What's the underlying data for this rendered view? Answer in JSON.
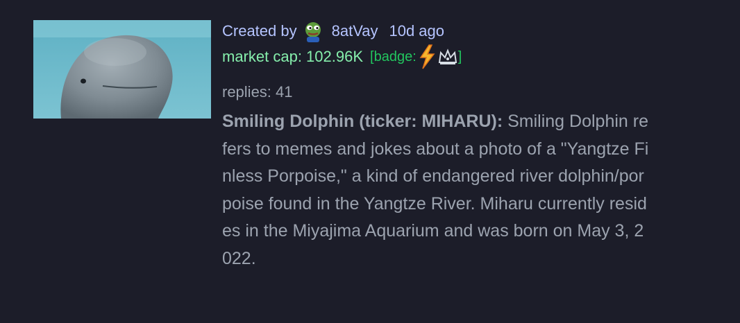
{
  "coin": {
    "created_by_label": "Created by",
    "creator": "8atVay",
    "created_ago": "10d ago",
    "market_cap": "market cap: 102.96K",
    "badge_open": "[badge:",
    "badge_close": "]",
    "badge_icons": [
      "lightning-icon",
      "crown-icon"
    ],
    "replies": "replies: 41",
    "title": "Smiling Dolphin (ticker: MIHARU):",
    "description": "Smiling Dolphin refers to memes and jokes about a photo of a \"Yangtze Finless Porpoise,\" a kind of endangered river dolphin/porpoise found in the Yangtze River. Miharu currently resides in the Miyajima Aquarium and was born on May 3, 2022."
  },
  "colors": {
    "background": "#1c1d29",
    "creator_text": "#b5c4ff",
    "market_cap": "#86efac",
    "badge": "#22c55e",
    "body_text": "#9ca3af"
  }
}
